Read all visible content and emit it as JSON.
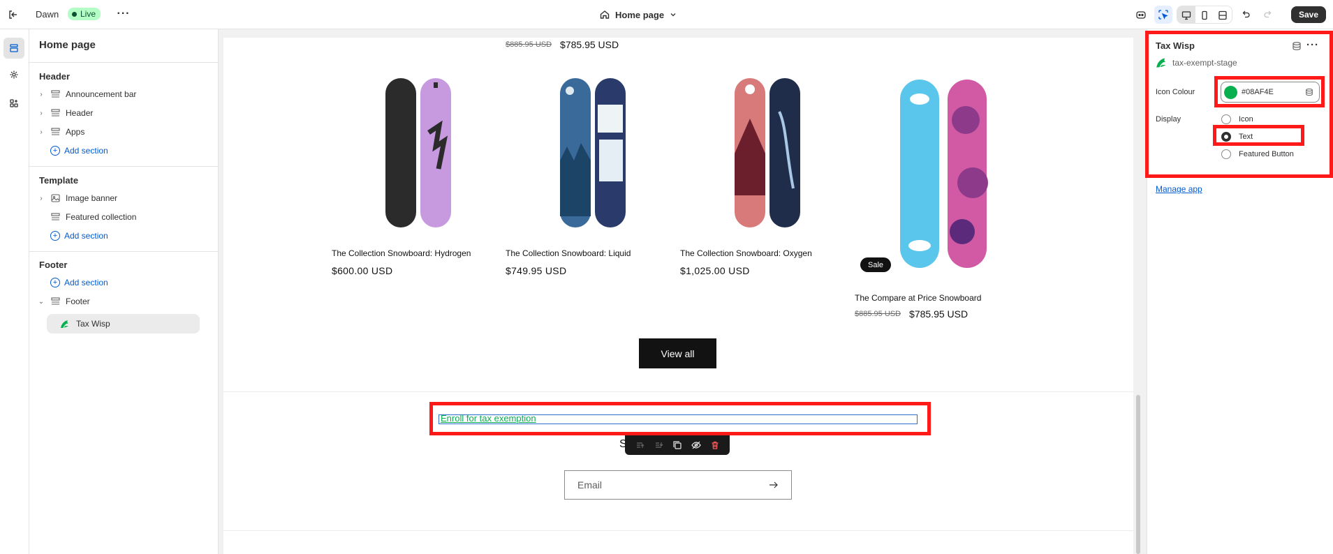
{
  "topbar": {
    "theme_name": "Dawn",
    "status_badge": "Live",
    "page_selector": "Home page",
    "save_label": "Save"
  },
  "sidebar": {
    "title": "Home page",
    "groups": [
      {
        "label": "Header",
        "items": [
          {
            "label": "Announcement bar",
            "icon": "section-icon"
          },
          {
            "label": "Header",
            "icon": "section-icon"
          },
          {
            "label": "Apps",
            "icon": "section-icon"
          }
        ],
        "add_label": "Add section"
      },
      {
        "label": "Template",
        "items": [
          {
            "label": "Image banner",
            "icon": "image-icon"
          },
          {
            "label": "Featured collection",
            "icon": "section-icon"
          }
        ],
        "add_label": "Add section"
      },
      {
        "label": "Footer",
        "add_label": "Add section",
        "items": [
          {
            "label": "Footer",
            "icon": "section-icon"
          }
        ],
        "selected_block": "Tax Wisp"
      }
    ]
  },
  "canvas": {
    "top_price": {
      "old": "$885.95 USD",
      "new": "$785.95 USD"
    },
    "products": [
      {
        "title": "The Collection Snowboard: Hydrogen",
        "price": "$600.00 USD",
        "colors": [
          "#2b2b2b",
          "#c79ae0"
        ]
      },
      {
        "title": "The Collection Snowboard: Liquid",
        "price": "$749.95 USD",
        "colors": [
          "#3a6a9a",
          "#2a3a6a"
        ]
      },
      {
        "title": "The Collection Snowboard: Oxygen",
        "price": "$1,025.00 USD",
        "colors": [
          "#d97a7a",
          "#1f2d4a"
        ]
      },
      {
        "title": "The Compare at Price Snowboard",
        "price_old": "$885.95 USD",
        "price": "$785.95 USD",
        "badge": "Sale",
        "colors": [
          "#5bc6ec",
          "#d25aa4"
        ]
      }
    ],
    "view_all_label": "View all",
    "enroll_link": "Enroll for tax exemption",
    "subscribe_text": "S                          s",
    "email_placeholder": "Email"
  },
  "right_panel": {
    "app_title": "Tax Wisp",
    "app_handle": "tax-exempt-stage",
    "icon_colour_label": "Icon Colour",
    "icon_colour_value": "#08AF4E",
    "icon_colour_hex": "#08af4e",
    "display_label": "Display",
    "display_options": [
      "Icon",
      "Text",
      "Featured Button"
    ],
    "display_selected": "Text",
    "manage_app_label": "Manage app"
  },
  "colors": {
    "accent_link": "#005bd3",
    "brand_green": "#08af4e",
    "highlight_red": "#ff1a1a",
    "live_badge_bg": "#b4fec6"
  }
}
